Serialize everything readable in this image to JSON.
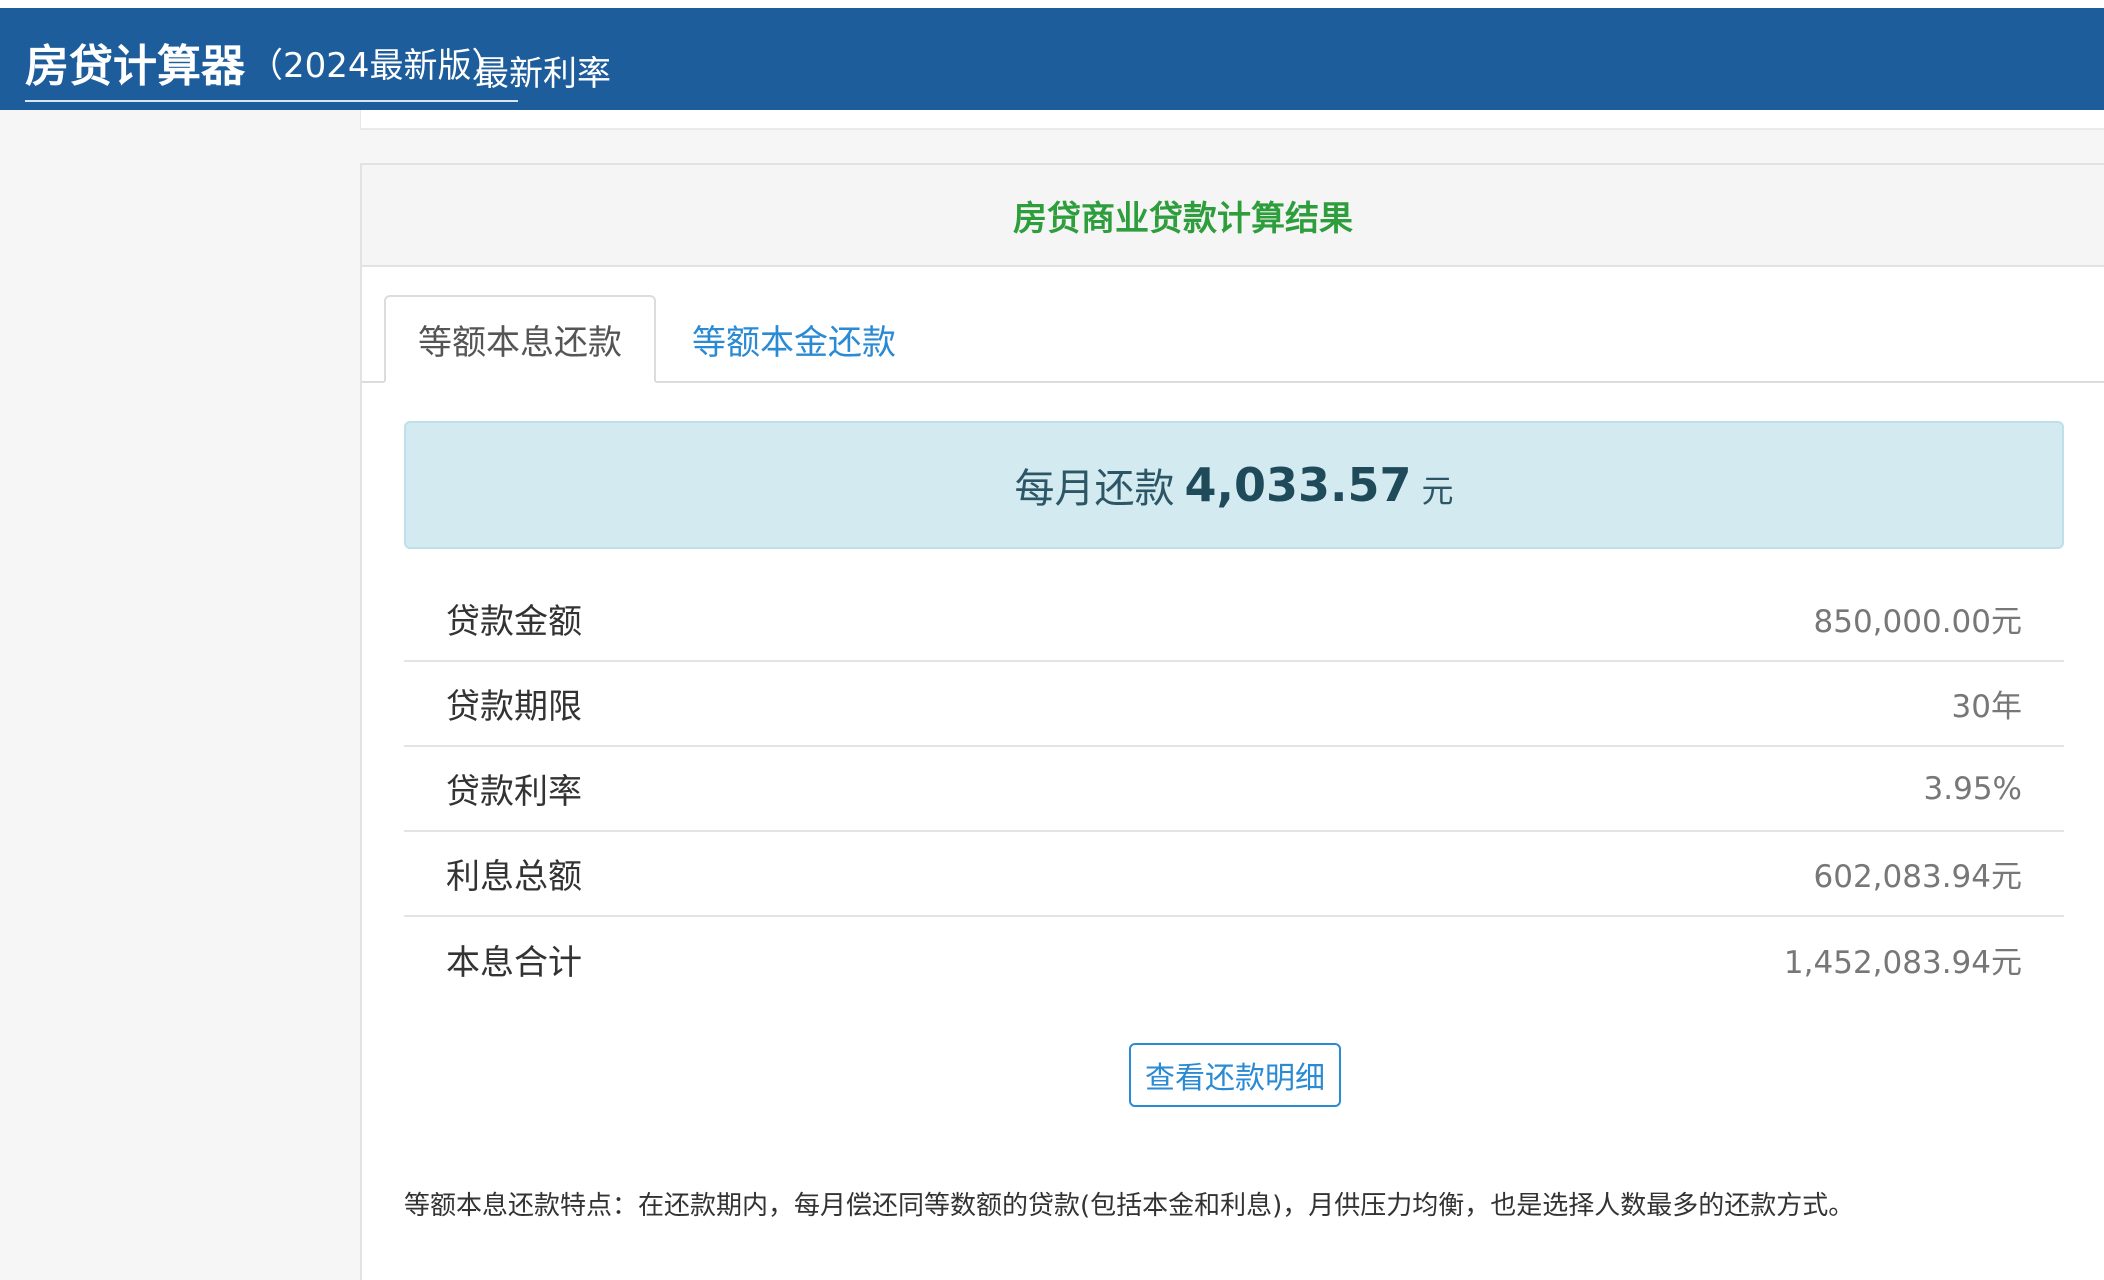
{
  "header": {
    "title": "房贷计算器",
    "version": "（2024最新版）",
    "nav_link": "最新利率"
  },
  "result_card": {
    "title": "房贷商业贷款计算结果",
    "tabs": [
      {
        "label": "等额本息还款",
        "active": true
      },
      {
        "label": "等额本金还款",
        "active": false
      }
    ],
    "monthly": {
      "label": "每月还款",
      "value": "4,033.57",
      "unit": "元"
    },
    "rows": [
      {
        "label": "贷款金额",
        "value": "850,000.00元"
      },
      {
        "label": "贷款期限",
        "value": "30年"
      },
      {
        "label": "贷款利率",
        "value": "3.95%"
      },
      {
        "label": "利息总额",
        "value": "602,083.94元"
      },
      {
        "label": "本息合计",
        "value": "1,452,083.94元"
      }
    ],
    "detail_button": "查看还款明细",
    "note": "等额本息还款特点：在还款期内，每月偿还同等数额的贷款(包括本金和利息)，月供压力均衡，也是选择人数最多的还款方式。"
  },
  "colors": {
    "header_bg": "#1e5d9b",
    "title_green": "#2e9e3d",
    "link_blue": "#2a8ad3",
    "highlight_bg": "#d3eaf0"
  }
}
